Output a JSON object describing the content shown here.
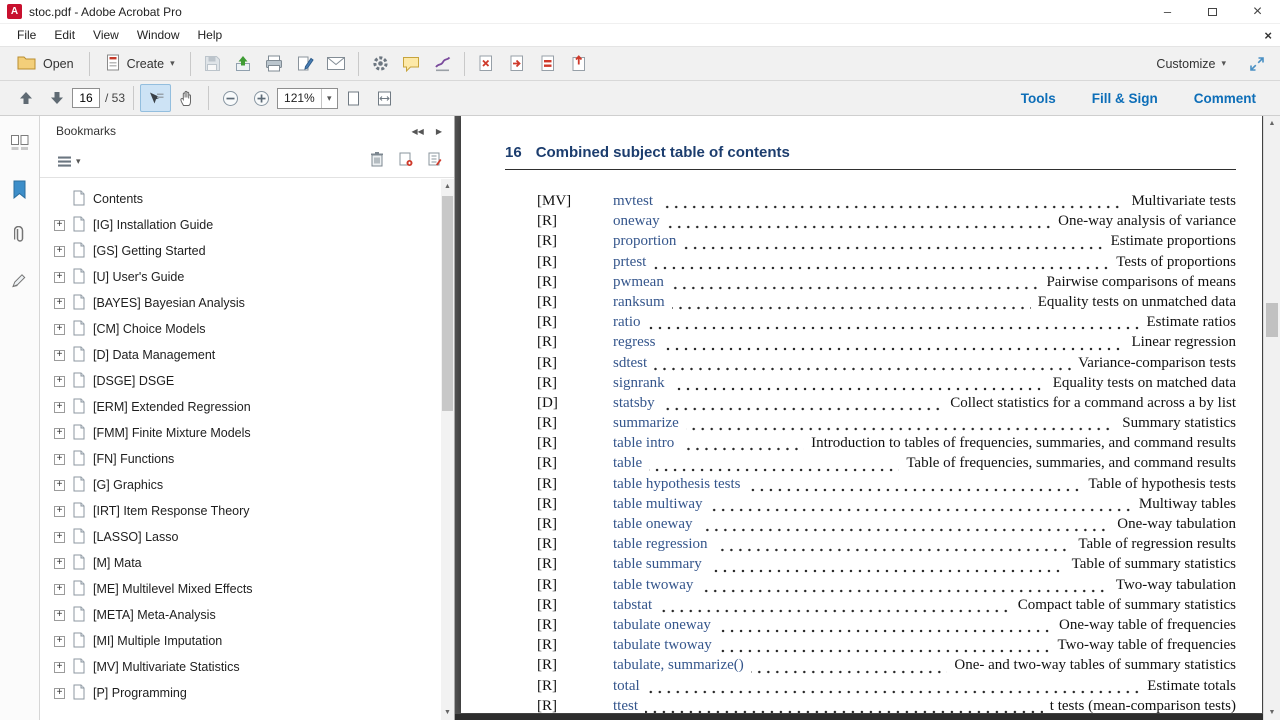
{
  "colors": {
    "accent": "#0d6eb8",
    "heading": "#1c3d6e",
    "keyword": "#35568c",
    "doc-bg": "#535353"
  },
  "icons": {
    "caret_down": "▾",
    "collapse_left": "◀◀",
    "expand_right": "▶",
    "scroll_up": "▲",
    "scroll_down": "▼",
    "minimize": "–",
    "close": "×"
  },
  "window": {
    "title": "stoc.pdf - Adobe Acrobat Pro",
    "menu": [
      "File",
      "Edit",
      "View",
      "Window",
      "Help"
    ]
  },
  "toolbar": {
    "open": "Open",
    "create": "Create",
    "customize": "Customize"
  },
  "navbar": {
    "page_current": "16",
    "page_total": "/ 53",
    "zoom": "121%",
    "tools": "Tools",
    "fill_sign": "Fill & Sign",
    "comment": "Comment"
  },
  "bookmarks": {
    "title": "Bookmarks",
    "items": [
      {
        "label": "Contents",
        "expander": ""
      },
      {
        "label": "[IG] Installation Guide",
        "expander": "+"
      },
      {
        "label": "[GS] Getting Started",
        "expander": "+"
      },
      {
        "label": "[U] User's Guide",
        "expander": "+"
      },
      {
        "label": "[BAYES] Bayesian Analysis",
        "expander": "+"
      },
      {
        "label": "[CM] Choice Models",
        "expander": "+"
      },
      {
        "label": "[D] Data Management",
        "expander": "+"
      },
      {
        "label": "[DSGE] DSGE",
        "expander": "+"
      },
      {
        "label": "[ERM] Extended Regression",
        "expander": "+"
      },
      {
        "label": "[FMM] Finite Mixture Models",
        "expander": "+"
      },
      {
        "label": "[FN] Functions",
        "expander": "+"
      },
      {
        "label": "[G] Graphics",
        "expander": "+"
      },
      {
        "label": "[IRT] Item Response Theory",
        "expander": "+"
      },
      {
        "label": "[LASSO] Lasso",
        "expander": "+"
      },
      {
        "label": "[M] Mata",
        "expander": "+"
      },
      {
        "label": "[ME] Multilevel Mixed Effects",
        "expander": "+"
      },
      {
        "label": "[META] Meta-Analysis",
        "expander": "+"
      },
      {
        "label": "[MI] Multiple Imputation",
        "expander": "+"
      },
      {
        "label": "[MV] Multivariate Statistics",
        "expander": "+"
      },
      {
        "label": "[P] Programming",
        "expander": "+"
      }
    ]
  },
  "page": {
    "heading_number": "16",
    "heading_title": "Combined subject table of contents",
    "entries": [
      {
        "tag": "[MV]",
        "keyword": "mvtest",
        "desc": "Multivariate tests"
      },
      {
        "tag": "[R]",
        "keyword": "oneway",
        "desc": "One-way analysis of variance"
      },
      {
        "tag": "[R]",
        "keyword": "proportion",
        "desc": "Estimate proportions"
      },
      {
        "tag": "[R]",
        "keyword": "prtest",
        "desc": "Tests of proportions"
      },
      {
        "tag": "[R]",
        "keyword": "pwmean",
        "desc": "Pairwise comparisons of means"
      },
      {
        "tag": "[R]",
        "keyword": "ranksum",
        "desc": "Equality tests on unmatched data"
      },
      {
        "tag": "[R]",
        "keyword": "ratio",
        "desc": "Estimate ratios"
      },
      {
        "tag": "[R]",
        "keyword": "regress",
        "desc": "Linear regression"
      },
      {
        "tag": "[R]",
        "keyword": "sdtest",
        "desc": "Variance-comparison tests"
      },
      {
        "tag": "[R]",
        "keyword": "signrank",
        "desc": "Equality tests on matched data"
      },
      {
        "tag": "[D]",
        "keyword": "statsby",
        "desc": "Collect statistics for a command across a by list"
      },
      {
        "tag": "[R]",
        "keyword": "summarize",
        "desc": "Summary statistics"
      },
      {
        "tag": "[R]",
        "keyword": "table intro",
        "desc": "Introduction to tables of frequencies, summaries, and command results"
      },
      {
        "tag": "[R]",
        "keyword": "table",
        "desc": "Table of frequencies, summaries, and command results"
      },
      {
        "tag": "[R]",
        "keyword": "table hypothesis tests",
        "desc": "Table of hypothesis tests"
      },
      {
        "tag": "[R]",
        "keyword": "table multiway",
        "desc": "Multiway tables"
      },
      {
        "tag": "[R]",
        "keyword": "table oneway",
        "desc": "One-way tabulation"
      },
      {
        "tag": "[R]",
        "keyword": "table regression",
        "desc": "Table of regression results"
      },
      {
        "tag": "[R]",
        "keyword": "table summary",
        "desc": "Table of summary statistics"
      },
      {
        "tag": "[R]",
        "keyword": "table twoway",
        "desc": "Two-way tabulation"
      },
      {
        "tag": "[R]",
        "keyword": "tabstat",
        "desc": "Compact table of summary statistics"
      },
      {
        "tag": "[R]",
        "keyword": "tabulate oneway",
        "desc": "One-way table of frequencies"
      },
      {
        "tag": "[R]",
        "keyword": "tabulate twoway",
        "desc": "Two-way table of frequencies"
      },
      {
        "tag": "[R]",
        "keyword": "tabulate, summarize()",
        "desc": "One- and two-way tables of summary statistics"
      },
      {
        "tag": "[R]",
        "keyword": "total",
        "desc": "Estimate totals"
      },
      {
        "tag": "[R]",
        "keyword": "ttest",
        "desc": "t tests (mean-comparison tests)"
      }
    ]
  }
}
